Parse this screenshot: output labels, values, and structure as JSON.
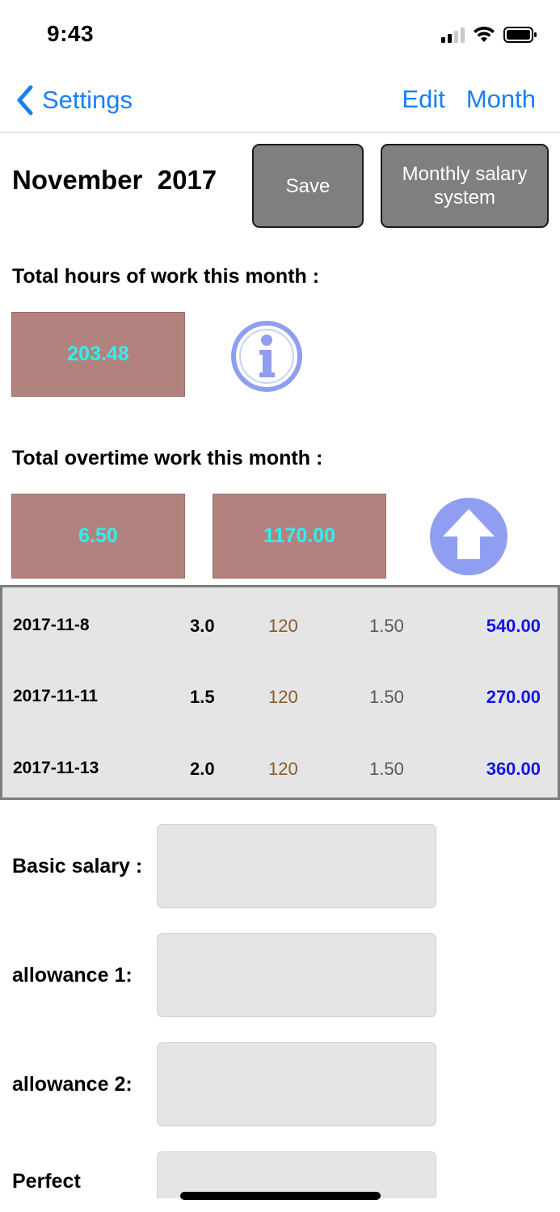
{
  "status_bar": {
    "time": "9:43",
    "icons": [
      "signal-icon",
      "wifi-icon",
      "battery-icon"
    ]
  },
  "nav": {
    "back_label": "Settings",
    "edit_label": "Edit",
    "month_label": "Month",
    "accent_color": "#1a7ff5"
  },
  "header": {
    "month_title": "November  2017",
    "save_label": "Save",
    "salary_system_label": "Monthly salary system"
  },
  "hours": {
    "label": "Total hours of work this month :",
    "total": "203.48",
    "info_icon": "info-icon"
  },
  "overtime": {
    "label": "Total overtime work this month :",
    "hours_total": "6.50",
    "amount_total": "1170.00",
    "upload_icon": "arrow-up-icon",
    "rows": [
      {
        "date": "2017-11-8",
        "hours": "3.0",
        "rate": "120",
        "multiplier": "1.50",
        "amount": "540.00"
      },
      {
        "date": "2017-11-11",
        "hours": "1.5",
        "rate": "120",
        "multiplier": "1.50",
        "amount": "270.00"
      },
      {
        "date": "2017-11-13",
        "hours": "2.0",
        "rate": "120",
        "multiplier": "1.50",
        "amount": "360.00"
      }
    ]
  },
  "salary_fields": [
    {
      "label": "Basic salary :",
      "value": ""
    },
    {
      "label": "allowance 1:",
      "value": ""
    },
    {
      "label": "allowance 2:",
      "value": ""
    },
    {
      "label": "Perfect",
      "value": ""
    }
  ],
  "colors": {
    "value_box_bg": "#b2837e",
    "value_box_text": "#2ef0ee",
    "button_bg": "#7f7f7f",
    "table_bg": "#e5e5e5",
    "amount_color": "#1414e6",
    "rate_color": "#8b5a2b",
    "icon_color": "#8f9ef0"
  }
}
